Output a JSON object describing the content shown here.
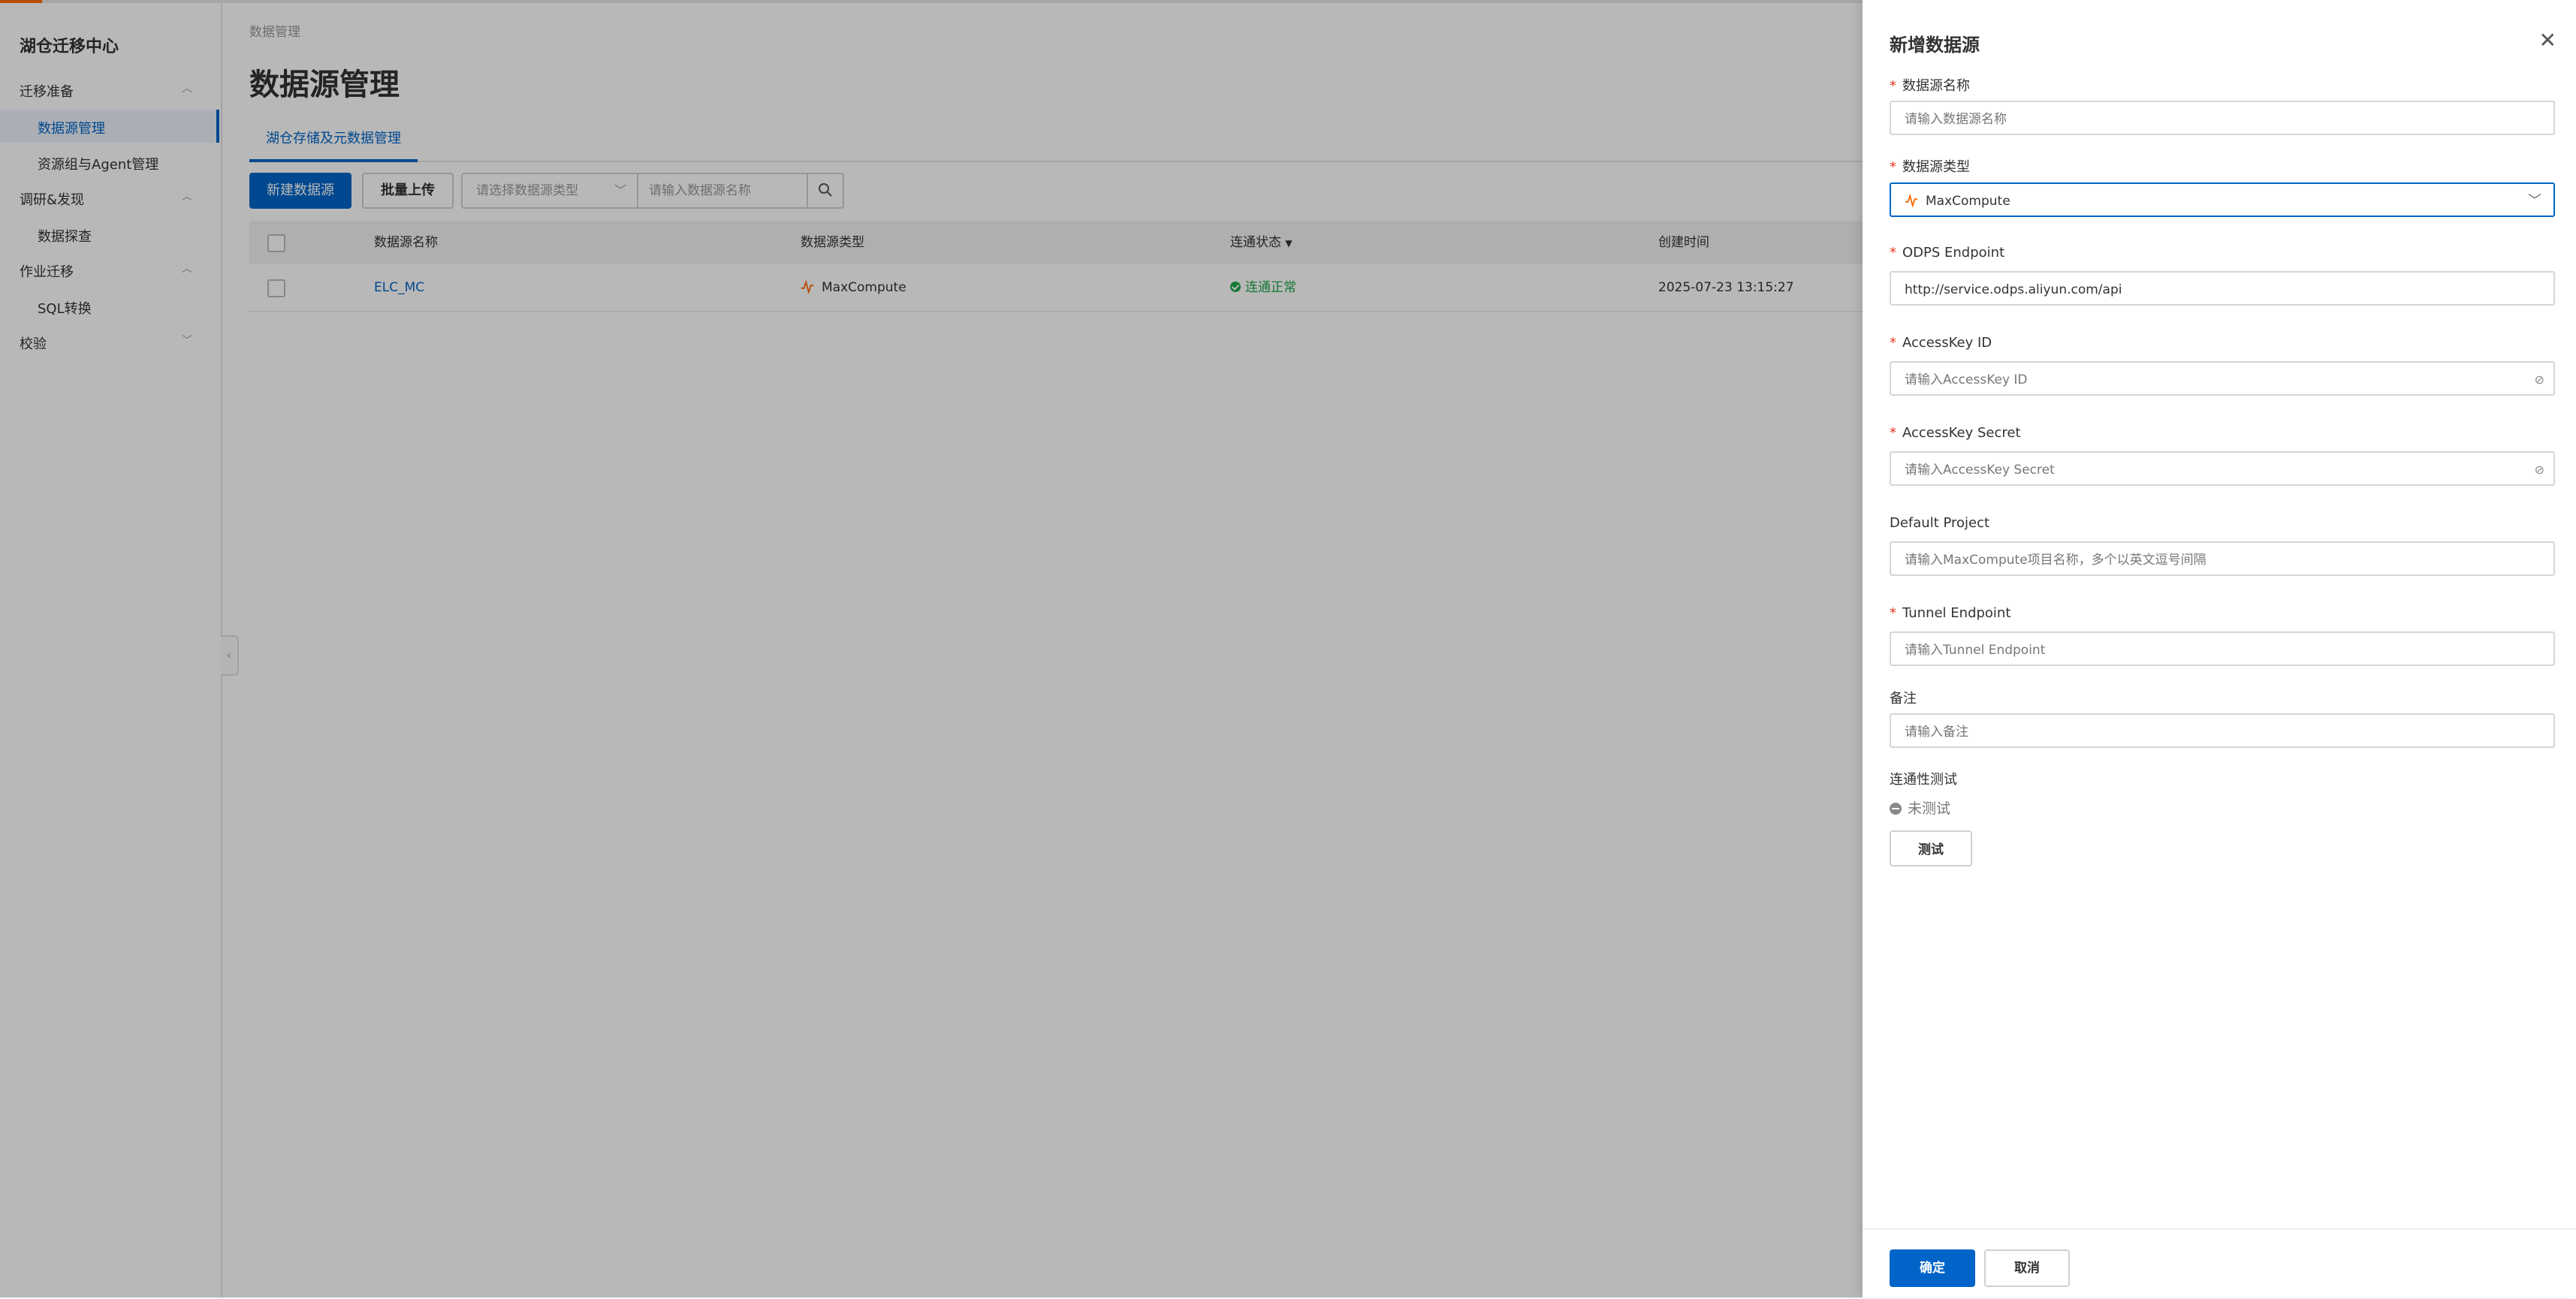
{
  "sidebar": {
    "title": "湖仓迁移中心",
    "groups": [
      {
        "label": "迁移准备"
      },
      {
        "label": "调研&发现"
      },
      {
        "label": "作业迁移"
      },
      {
        "label": "校验"
      }
    ],
    "items": [
      {
        "label": "数据源管理"
      },
      {
        "label": "资源组与Agent管理"
      },
      {
        "label": "数据探查"
      },
      {
        "label": "SQL转换"
      }
    ]
  },
  "main": {
    "breadcrumb": "数据管理",
    "title": "数据源管理",
    "tab": "湖仓存储及元数据管理",
    "toolbar": {
      "new_label": "新建数据源",
      "upload_label": "批量上传",
      "type_select_placeholder": "请选择数据源类型",
      "name_search_placeholder": "请输入数据源名称"
    },
    "table": {
      "headers": [
        "数据源名称",
        "数据源类型",
        "连通状态",
        "创建时间"
      ],
      "rows": [
        {
          "name": "ELC_MC",
          "type": "MaxCompute",
          "status": "连通正常",
          "created": "2025-07-23 13:15:27"
        }
      ]
    }
  },
  "drawer": {
    "title": "新增数据源",
    "fields": {
      "name_label": "数据源名称",
      "name_placeholder": "请输入数据源名称",
      "type_label": "数据源类型",
      "type_value": "MaxCompute",
      "odps_label": "ODPS Endpoint",
      "odps_value": "http://service.odps.aliyun.com/api",
      "ak_id_label": "AccessKey ID",
      "ak_id_placeholder": "请输入AccessKey ID",
      "ak_secret_label": "AccessKey Secret",
      "ak_secret_placeholder": "请输入AccessKey Secret",
      "project_label": "Default Project",
      "project_placeholder": "请输入MaxCompute项目名称，多个以英文逗号间隔",
      "tunnel_label": "Tunnel Endpoint",
      "tunnel_placeholder": "请输入Tunnel Endpoint",
      "remark_label": "备注",
      "remark_placeholder": "请输入备注",
      "conn_label": "连通性测试",
      "conn_status": "未测试",
      "test_label": "测试"
    },
    "footer": {
      "ok_label": "确定",
      "cancel_label": "取消"
    }
  },
  "colors": {
    "primary": "#0064c8",
    "success": "#1ba84a",
    "required": "#e8361f",
    "maxcompute": "#ff6a00"
  }
}
